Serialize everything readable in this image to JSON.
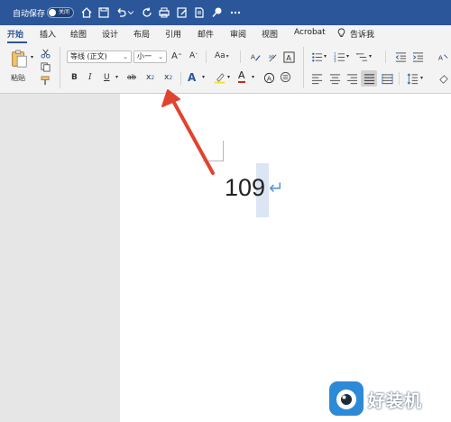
{
  "titlebar": {
    "autosave_label": "自动保存",
    "toggle_text": "关闭",
    "icons": [
      "home-icon",
      "save-icon",
      "undo-icon",
      "dropdown-icon",
      "redo-icon",
      "print-icon",
      "edit-icon",
      "document-icon",
      "pin-icon",
      "more-icon"
    ]
  },
  "tabs": [
    "开始",
    "插入",
    "绘图",
    "设计",
    "布局",
    "引用",
    "邮件",
    "审阅",
    "视图",
    "Acrobat"
  ],
  "tell_me": "告诉我",
  "clipboard": {
    "paste_label": "粘贴"
  },
  "font": {
    "family": "等线 (正文)",
    "size": "小一",
    "grow": "A",
    "shrink": "A",
    "change_case": "Aa",
    "bold": "B",
    "italic": "I",
    "underline": "U",
    "strikethrough": "ab",
    "subscript": "x",
    "superscript": "x",
    "text_effects": "A",
    "font_color": "A"
  },
  "document": {
    "main_text": "109",
    "paragraph_mark": "↵"
  },
  "watermark": {
    "text": "好装机"
  },
  "colors": {
    "titlebar": "#2b579a",
    "accent": "#2b579a",
    "arrow": "#e0442e",
    "selection": "#dbe5f4"
  }
}
